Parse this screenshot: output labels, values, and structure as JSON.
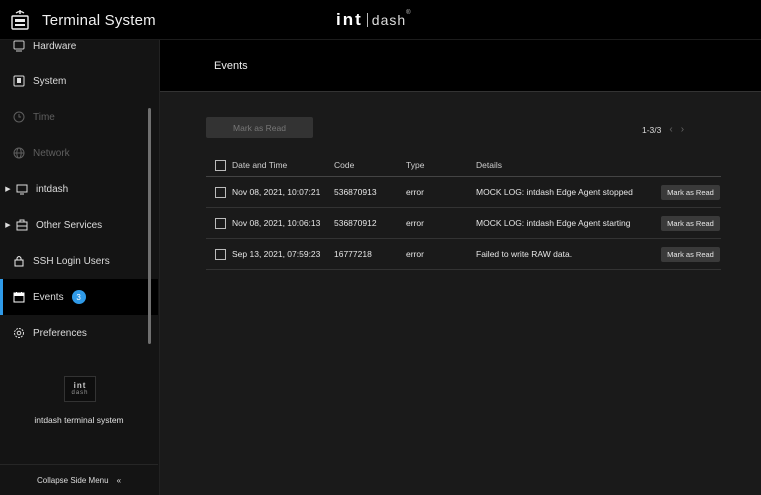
{
  "app": {
    "title": "Terminal System",
    "logo_main": "int",
    "logo_sub": "dash",
    "logo_mark": "®"
  },
  "sidebar": {
    "items": [
      {
        "label": "Hardware",
        "icon": "hardware-icon",
        "disabled": false,
        "caret": false
      },
      {
        "label": "System",
        "icon": "system-icon",
        "disabled": false,
        "caret": false
      },
      {
        "label": "Time",
        "icon": "clock-icon",
        "disabled": true,
        "caret": false
      },
      {
        "label": "Network",
        "icon": "globe-icon",
        "disabled": true,
        "caret": false
      },
      {
        "label": "intdash",
        "icon": "monitor-icon",
        "disabled": false,
        "caret": true
      },
      {
        "label": "Other Services",
        "icon": "services-icon",
        "disabled": false,
        "caret": true
      },
      {
        "label": "SSH Login Users",
        "icon": "lock-icon",
        "disabled": false,
        "caret": false
      },
      {
        "label": "Events",
        "icon": "calendar-icon",
        "disabled": false,
        "caret": false,
        "active": true,
        "badge": "3"
      },
      {
        "label": "Preferences",
        "icon": "gear-icon",
        "disabled": false,
        "caret": false
      }
    ],
    "logo_a": "int",
    "logo_b": "dash",
    "caption": "intdash terminal system",
    "collapse_label": "Collapse Side Menu",
    "collapse_icon": "«"
  },
  "page": {
    "title": "Events",
    "mark_all_label": "Mark as Read",
    "pager": {
      "range": "1-3/3",
      "prev": "‹",
      "next": "›"
    }
  },
  "table": {
    "headers": {
      "date": "Date and Time",
      "code": "Code",
      "type": "Type",
      "details": "Details"
    },
    "rows": [
      {
        "date": "Nov 08, 2021, 10:07:21",
        "code": "536870913",
        "type": "error",
        "details": "MOCK LOG: intdash Edge Agent stopped",
        "action": "Mark as Read"
      },
      {
        "date": "Nov 08, 2021, 10:06:13",
        "code": "536870912",
        "type": "error",
        "details": "MOCK LOG: intdash Edge Agent starting",
        "action": "Mark as Read"
      },
      {
        "date": "Sep 13, 2021, 07:59:23",
        "code": "16777218",
        "type": "error",
        "details": "Failed to write RAW data.",
        "action": "Mark as Read"
      }
    ]
  },
  "colors": {
    "accent": "#2f9ae8",
    "background": "#1a1a1a",
    "sidebar": "#141414"
  }
}
